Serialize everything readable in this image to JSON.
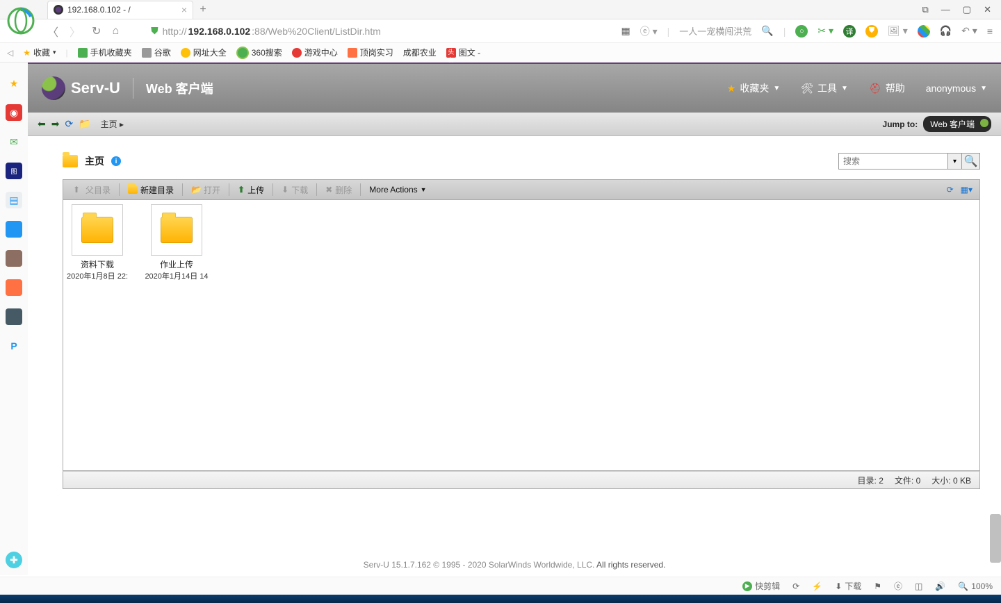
{
  "browser": {
    "tab_title": "192.168.0.102 - /",
    "url_prefix": "http://",
    "url_host": "192.168.0.102",
    "url_path": ":88/Web%20Client/ListDir.htm",
    "search_hint": "一人一宠横闯洪荒",
    "bookmarks": {
      "fav": "收藏",
      "mobile": "手机收藏夹",
      "google": "谷歌",
      "sites": "网址大全",
      "s360": "360搜索",
      "game": "游戏中心",
      "dinggang": "顶岗实习",
      "chengdu": "成都农业",
      "pics": "图文 -"
    },
    "win": {
      "min": "—",
      "max": "▢",
      "close": "✕",
      "ext": "⧉"
    }
  },
  "servu": {
    "brand": "Serv-U",
    "title": "Web 客户端",
    "menu": {
      "fav": "收藏夹",
      "tools": "工具",
      "help": "帮助",
      "user": "anonymous"
    },
    "crumb": "主页",
    "jump_label": "Jump to:",
    "jump_value": "Web 客户端",
    "location": "主页",
    "search_placeholder": "搜索",
    "actions": {
      "parent": "父目录",
      "newdir": "新建目录",
      "open": "打开",
      "upload": "上传",
      "download": "下载",
      "delete": "删除",
      "more": "More Actions"
    },
    "files": [
      {
        "name": "资料下载",
        "date": "2020年1月8日 22:"
      },
      {
        "name": "作业上传",
        "date": "2020年1月14日 14"
      }
    ],
    "status": {
      "dirs_lbl": "目录:",
      "dirs": "2",
      "files_lbl": "文件:",
      "files": "0",
      "size_lbl": "大小:",
      "size": "0 KB"
    },
    "footer_a": "Serv-U 15.1.7.162 © 1995 - 2020 SolarWinds Worldwide, LLC.",
    "footer_b": "All rights reserved."
  },
  "bottom": {
    "clip": "快剪辑",
    "download": "下载",
    "zoom": "100%"
  }
}
